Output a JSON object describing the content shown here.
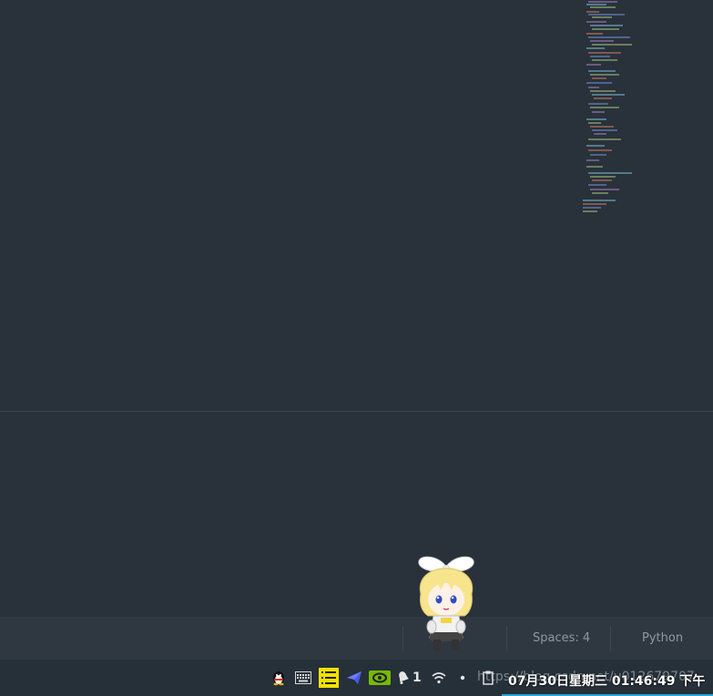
{
  "statusbar": {
    "indent": "Spaces: 4",
    "language": "Python"
  },
  "taskbar": {
    "tray_icons": [
      "qq-penguin-icon",
      "keyboard-icon",
      "notes-icon",
      "paper-plane-icon",
      "nvidia-icon",
      "notification-bell-icon",
      "wifi-icon",
      "network-dot-icon",
      "clipboard-icon"
    ],
    "notification_count": "1",
    "url_ghost": "https://blog.csdn.net/u012679707",
    "clock": "07月30日星期三 01:46:49 下午"
  },
  "colors": {
    "editor_bg": "#29313a",
    "statusbar_bg": "#2f3841",
    "taskbar_bg": "#263039",
    "accent": "#2aa7d8"
  }
}
